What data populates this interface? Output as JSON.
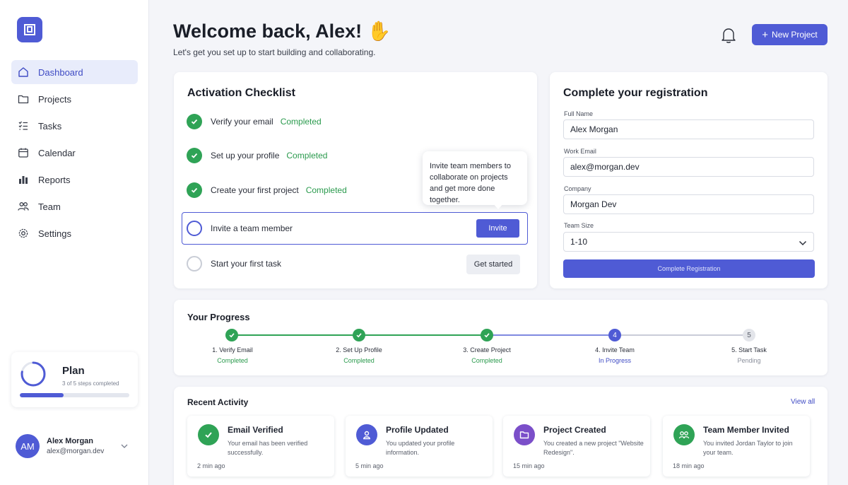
{
  "sidebar": {
    "items": [
      {
        "label": "Dashboard",
        "icon": "home-icon",
        "active": true
      },
      {
        "label": "Projects",
        "icon": "folder-icon"
      },
      {
        "label": "Tasks",
        "icon": "tasks-icon"
      },
      {
        "label": "Calendar",
        "icon": "calendar-icon"
      },
      {
        "label": "Reports",
        "icon": "bar-chart-icon"
      },
      {
        "label": "Team",
        "icon": "users-icon"
      },
      {
        "label": "Settings",
        "icon": "gear-icon"
      }
    ],
    "plan": {
      "title": "Plan",
      "subtitle": "3 of 5 steps completed",
      "progress": 0.4
    },
    "user": {
      "initials": "AM",
      "name": "Alex Morgan",
      "email": "alex@morgan.dev"
    }
  },
  "header": {
    "title": "Welcome back, Alex! ✋",
    "subtitle": "Let's get you set up to start building and collaborating.",
    "new_project_label": "New Project"
  },
  "checklist": {
    "title": "Activation Checklist",
    "items": [
      {
        "label": "Verify your email",
        "status": "Completed"
      },
      {
        "label": "Set up your profile",
        "status": "Completed"
      },
      {
        "label": "Create your first project",
        "status": "Completed"
      },
      {
        "label": "Invite a team member",
        "action": "Invite"
      },
      {
        "label": "Start your first task",
        "action": "Get started"
      }
    ],
    "tooltip": "Invite team members to collaborate on projects and get more done together."
  },
  "registration": {
    "title": "Complete your registration",
    "full_name_label": "Full Name",
    "full_name_value": "Alex Morgan",
    "work_email_label": "Work Email",
    "work_email_value": "alex@morgan.dev",
    "company_label": "Company",
    "company_value": "Morgan Dev",
    "team_size_label": "Team Size",
    "team_size_value": "1-10",
    "submit_label": "Complete Registration"
  },
  "progress": {
    "title": "Your Progress",
    "steps": [
      {
        "label": "1. Verify Email",
        "status": "Completed",
        "state": "done"
      },
      {
        "label": "2. Set Up Profile",
        "status": "Completed",
        "state": "done"
      },
      {
        "label": "3. Create Project",
        "status": "Completed",
        "state": "done"
      },
      {
        "label": "4. Invite Team",
        "status": "In Progress",
        "state": "current",
        "number": "4"
      },
      {
        "label": "5. Start Task",
        "status": "Pending",
        "state": "pending",
        "number": "5"
      }
    ]
  },
  "activity": {
    "title": "Recent Activity",
    "view_all": "View all",
    "items": [
      {
        "title": "Email Verified",
        "desc": "Your email has been verified successfully.",
        "time": "2 min ago",
        "icon": "check-icon",
        "color": "#2fa356"
      },
      {
        "title": "Profile Updated",
        "desc": "You updated your profile information.",
        "time": "5 min ago",
        "icon": "user-icon",
        "color": "#4f5bd5"
      },
      {
        "title": "Project Created",
        "desc": "You created a new project \"Website Redesign\".",
        "time": "15 min ago",
        "icon": "folder-icon",
        "color": "#7b4fc9"
      },
      {
        "title": "Team Member Invited",
        "desc": "You invited Jordan Taylor to join your team.",
        "time": "18 min ago",
        "icon": "team-icon",
        "color": "#2fa356"
      }
    ]
  },
  "colors": {
    "accent": "#4f5bd5",
    "success": "#2fa356",
    "purple": "#7b4fc9"
  }
}
